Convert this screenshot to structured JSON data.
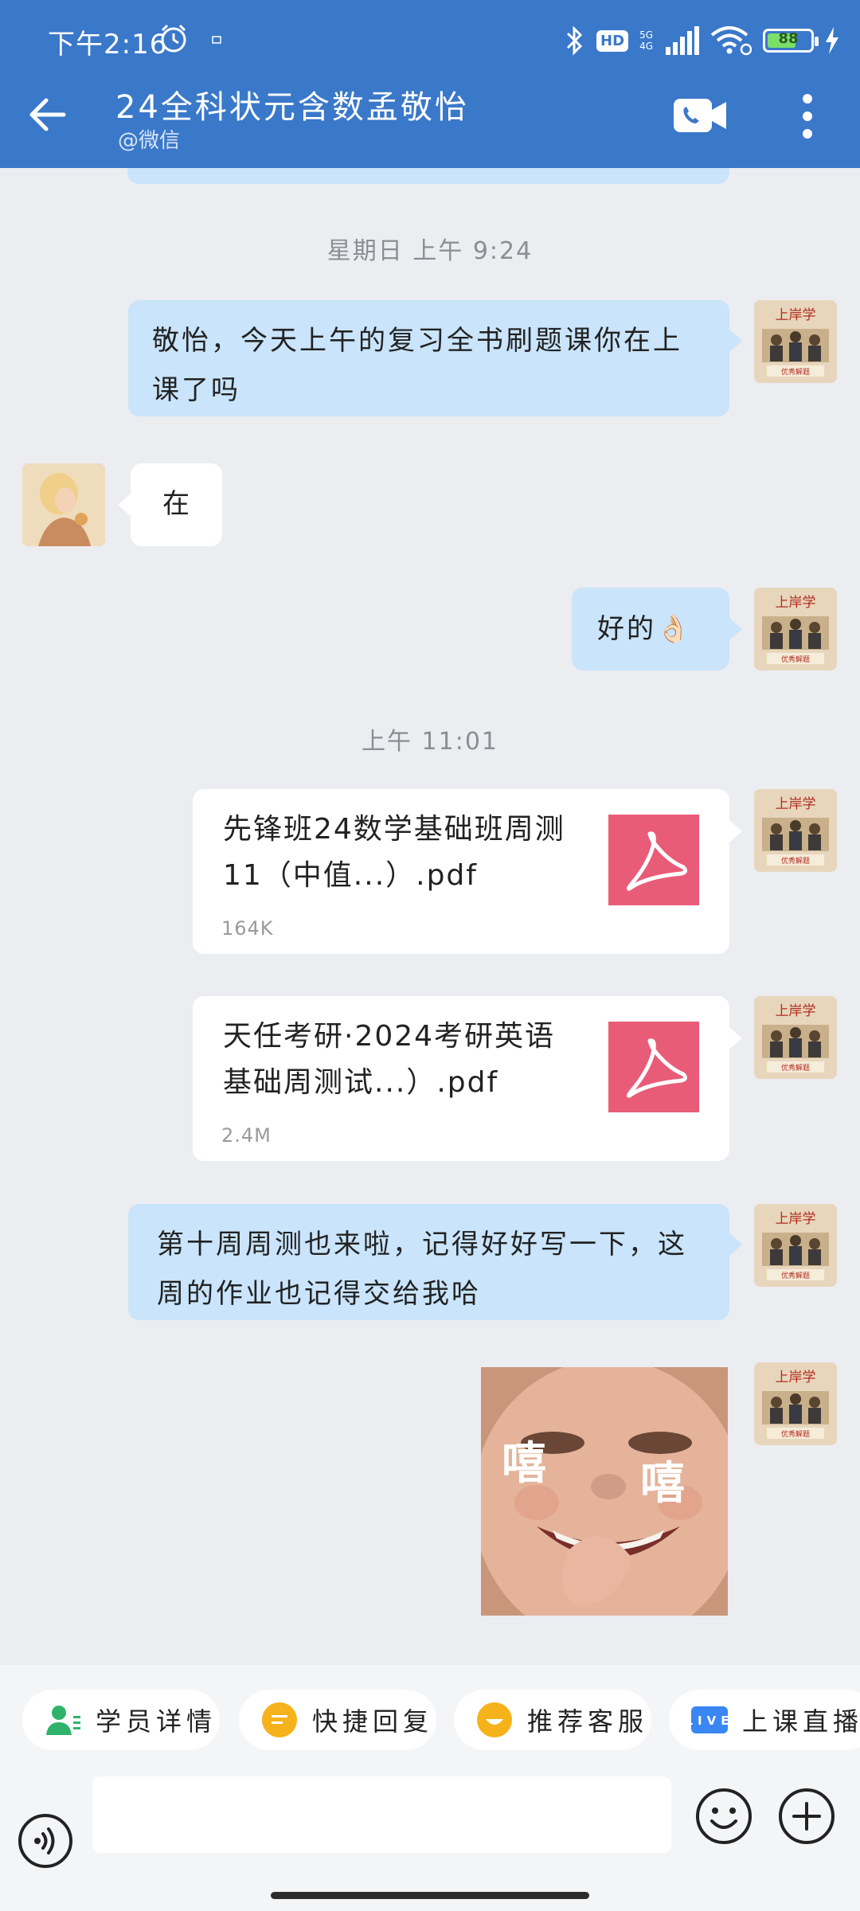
{
  "status_bar": {
    "time": "下午2:16",
    "network_top": "5G",
    "network_bottom": "4G",
    "hd": "HD",
    "battery": "88"
  },
  "header": {
    "title": "24全科状元含数孟敬怡",
    "subtitle": "@微信"
  },
  "messages": {
    "ts1": "星期日 上午 9:24",
    "m1": "敬怡，今天上午的复习全书刷题课你在上课了吗",
    "m2": "在",
    "m3": "好的👌🏻",
    "ts2": "上午 11:01",
    "file1": {
      "name": "先锋班24数学基础班周测11（中值...）.pdf",
      "size": "164K"
    },
    "file2": {
      "name": "天任考研·2024考研英语基础周测试...）.pdf",
      "size": "2.4M"
    },
    "m4": "第十周周测也来啦，记得好好写一下，这周的作业也记得交给我哈",
    "sticker_text_left": "嘻",
    "sticker_text_right": "嘻"
  },
  "agent_avatar_text": {
    "top": "上岸学",
    "bottom": "优秀解题"
  },
  "quick_actions": [
    {
      "label": "学员详情",
      "icon": "person-icon",
      "color": "#2fb36a"
    },
    {
      "label": "快捷回复",
      "icon": "quick-reply-icon",
      "color": "#f6b21a"
    },
    {
      "label": "推荐客服",
      "icon": "smile-icon",
      "color": "#f6b21a"
    },
    {
      "label": "上课直播",
      "icon": "live-icon",
      "color": "#3a86f2",
      "badge": "LIVE"
    }
  ],
  "input": {
    "placeholder": ""
  },
  "colors": {
    "header": "#3a78c9",
    "bubble_blue": "#c9e4fb",
    "pdf": "#e95c78"
  }
}
